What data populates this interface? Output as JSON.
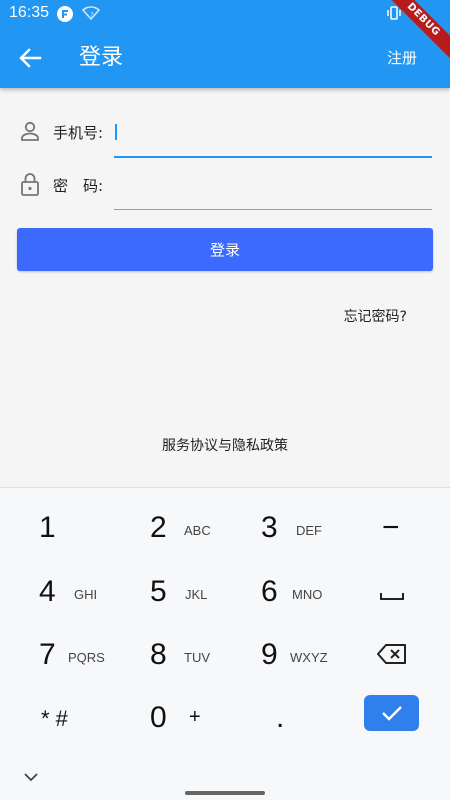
{
  "status_bar": {
    "time": "16:35",
    "icons": [
      "flutter-notification-icon",
      "wifi-icon",
      "vibrate-icon",
      "battery-icon"
    ]
  },
  "app_bar": {
    "title": "登录",
    "register_label": "注册",
    "debug_banner": "DEBUG",
    "back_icon": "arrow-back-icon"
  },
  "form": {
    "phone": {
      "label": "手机号:",
      "value": "",
      "icon": "person-icon"
    },
    "password": {
      "label": "密　码:",
      "value": "",
      "icon": "lock-icon"
    }
  },
  "login_button_label": "登录",
  "forgot_password_label": "忘记密码?",
  "policy_label": "服务协议与隐私政策",
  "keyboard": {
    "keys": [
      {
        "num": "1",
        "letters": ""
      },
      {
        "num": "2",
        "letters": "ABC"
      },
      {
        "num": "3",
        "letters": "DEF"
      },
      {
        "num": "−",
        "letters": ""
      },
      {
        "num": "4",
        "letters": "GHI"
      },
      {
        "num": "5",
        "letters": "JKL"
      },
      {
        "num": "6",
        "letters": "MNO"
      },
      {
        "num": "␣",
        "letters": ""
      },
      {
        "num": "7",
        "letters": "PQRS"
      },
      {
        "num": "8",
        "letters": "TUV"
      },
      {
        "num": "9",
        "letters": "WXYZ"
      },
      {
        "num": "⌫",
        "letters": ""
      },
      {
        "num": "* #",
        "letters": ""
      },
      {
        "num": "0",
        "letters": "+"
      },
      {
        "num": ".",
        "letters": ""
      }
    ]
  },
  "colors": {
    "app_bar": "#2196f3",
    "login_button": "#3d6afe",
    "confirm_key": "#2f80ed"
  }
}
